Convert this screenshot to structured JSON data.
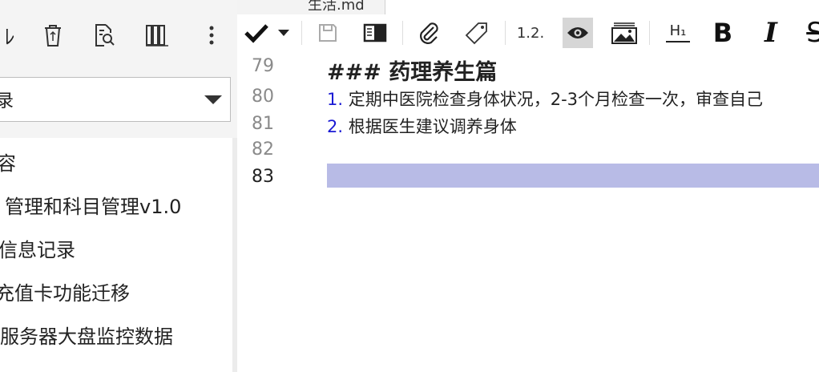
{
  "left_toolbar": {
    "icons": [
      "partial-icon",
      "trash-icon",
      "search-document-icon",
      "library-icon",
      "more-vertical-icon"
    ],
    "partial_glyph": "ﾚ"
  },
  "folder_select": {
    "value": "录"
  },
  "file_list": {
    "items": [
      "容",
      "管理和科目管理v1.0",
      "信息记录",
      "充值卡功能迁移",
      "服务器大盘监控数据"
    ]
  },
  "tab": {
    "label": "生活.md"
  },
  "editor_toolbar": {
    "ordered_list_label": "1.2.",
    "heading_label": "H₁",
    "bold_label": "B",
    "italic_label": "I",
    "strike_label": "S"
  },
  "editor": {
    "line_numbers": [
      "79",
      "80",
      "81",
      "82",
      "83"
    ],
    "active_line": "83",
    "heading_text": "### 药理养生篇",
    "list_items": [
      {
        "num": "1.",
        "text": "定期中医院检查身体状况，2-3个月检查一次，审查自己"
      },
      {
        "num": "2.",
        "text": "根据医生建议调养身体"
      }
    ]
  },
  "colors": {
    "current_line": "#b8bbe6",
    "list_number": "#1a1ad4",
    "active_toolbar_bg": "#d6d6d6"
  }
}
